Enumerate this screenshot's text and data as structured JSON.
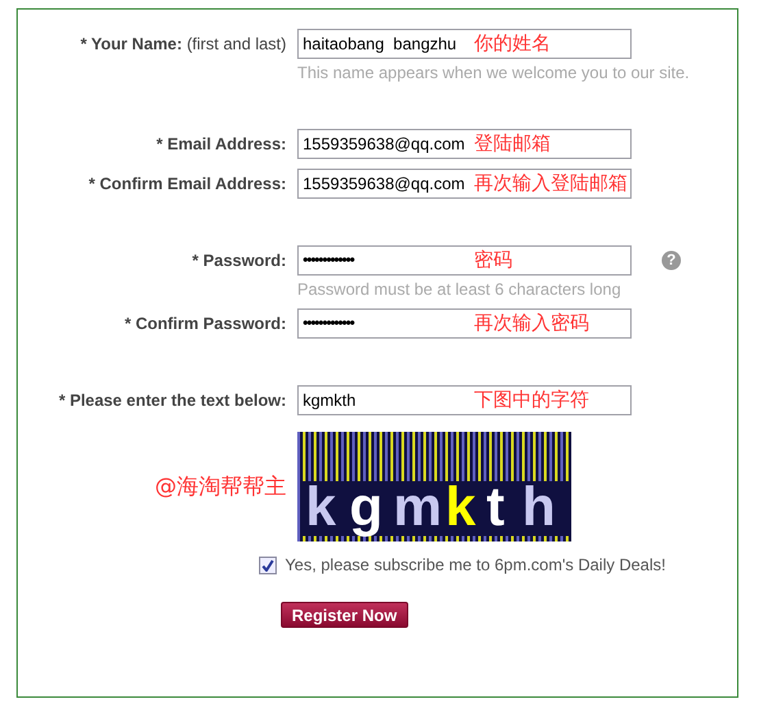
{
  "groups": [
    [
      {
        "label": "* Your Name:",
        "sublabel": "(first and last)",
        "kind": "text",
        "value": "haitaobang  bangzhu",
        "annotation": "你的姓名",
        "hint": "This name appears when we welcome you to our site."
      }
    ],
    [
      {
        "label": "* Email Address:",
        "kind": "text",
        "value": "1559359638@qq.com",
        "annotation": "登陆邮箱"
      },
      {
        "label": "* Confirm Email Address:",
        "kind": "text",
        "value": "1559359638@qq.com",
        "annotation": "再次输入登陆邮箱"
      }
    ],
    [
      {
        "label": "* Password:",
        "kind": "password",
        "value": "•••••••••••••",
        "annotation": "密码",
        "help": "?",
        "hint": "Password must be at least 6 characters long"
      },
      {
        "label": "* Confirm Password:",
        "kind": "password",
        "value": "•••••••••••••",
        "annotation": "再次输入密码"
      }
    ],
    [
      {
        "label": "* Please enter the text below:",
        "kind": "text",
        "value": "kgmkth",
        "annotation": "下图中的字符"
      }
    ]
  ],
  "captcha": {
    "side_note": "@海淘帮帮主",
    "characters": [
      {
        "char": "k",
        "color": "#c8c8f0"
      },
      {
        "char": "g",
        "color": "#ffffff"
      },
      {
        "char": "m",
        "color": "#c8c8f0"
      },
      {
        "char": "k",
        "color": "#ffff00"
      },
      {
        "char": "t",
        "color": "#ffffff"
      },
      {
        "char": "h",
        "color": "#c8c8f0"
      }
    ]
  },
  "subscribe": {
    "label": "Yes, please subscribe me to 6pm.com's Daily Deals!",
    "checked": true
  },
  "submit": "Register Now"
}
